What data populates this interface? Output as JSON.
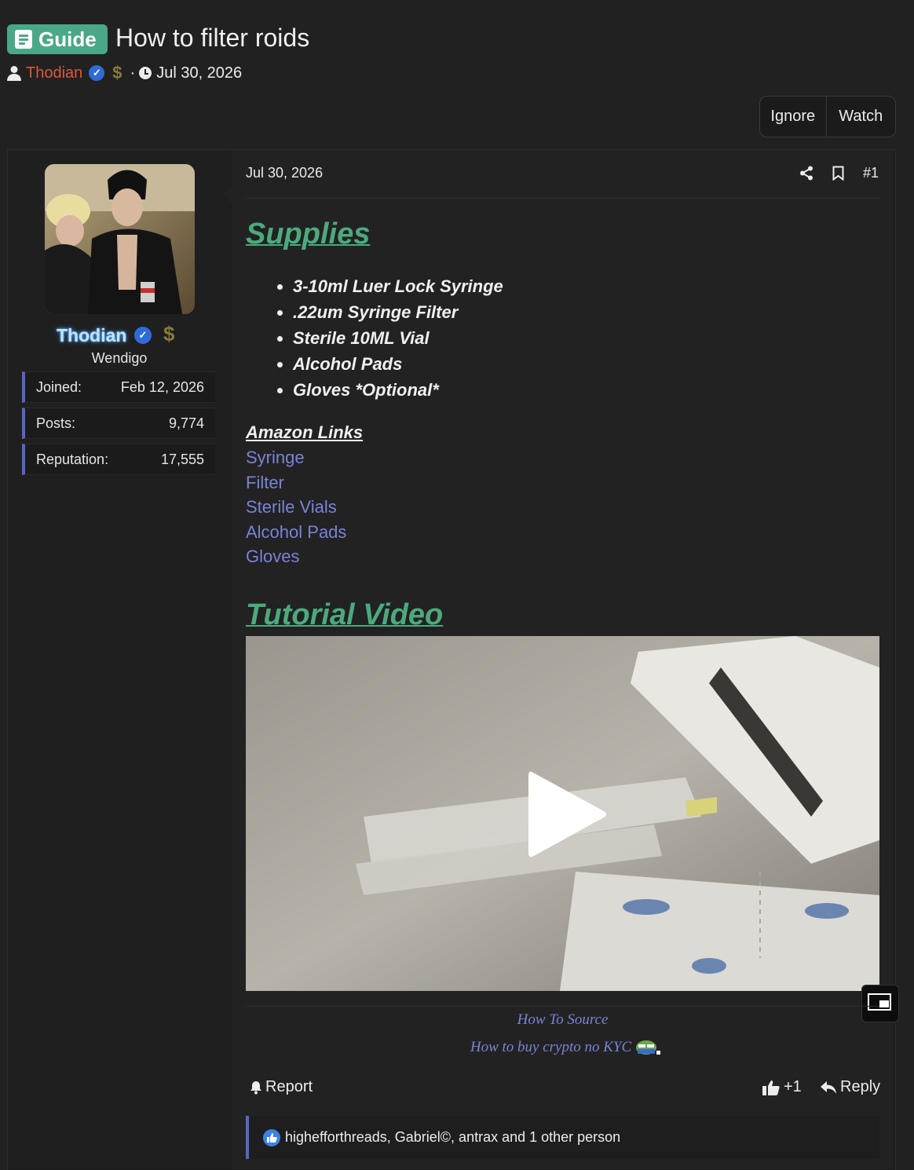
{
  "header": {
    "prefix_badge": "Guide",
    "title": "How to filter roids",
    "author": "Thodian",
    "separator": "·",
    "date": "Jul 30, 2026"
  },
  "thread_actions": {
    "ignore": "Ignore",
    "watch": "Watch"
  },
  "user": {
    "name": "Thodian",
    "title": "Wendigo",
    "stats": [
      {
        "label": "Joined:",
        "value": "Feb 12, 2026"
      },
      {
        "label": "Posts:",
        "value": "9,774"
      },
      {
        "label": "Reputation:",
        "value": "17,555"
      }
    ]
  },
  "post": {
    "date": "Jul 30, 2026",
    "number": "#1",
    "supplies_heading": "Supplies",
    "supplies": [
      "3-10ml Luer Lock Syringe",
      ".22um Syringe Filter",
      "Sterile 10ML Vial",
      "Alcohol Pads",
      "Gloves *Optional*"
    ],
    "links_heading": "Amazon Links",
    "links": [
      "Syringe",
      "Filter",
      "Sterile Vials",
      "Alcohol Pads",
      "Gloves"
    ],
    "video_heading": "Tutorial Video",
    "footer_links": [
      "How To Source",
      "How to buy crypto no KYC"
    ],
    "report": "Report",
    "reaction_count": "+1",
    "reply": "Reply",
    "reactions_text": "highefforthreads, Gabriel©, antrax and 1 other person"
  },
  "colors": {
    "accent_green": "#4caa7c",
    "link_blue": "#7a83d6",
    "author_red": "#e0563b",
    "stat_border": "#5865c7"
  },
  "icons": [
    "book-icon",
    "user-icon",
    "verified-icon",
    "dollar-icon",
    "clock-icon",
    "share-icon",
    "bookmark-icon",
    "play-icon",
    "pip-icon",
    "bell-icon",
    "thumbs-up-icon",
    "reply-icon",
    "like-icon"
  ]
}
